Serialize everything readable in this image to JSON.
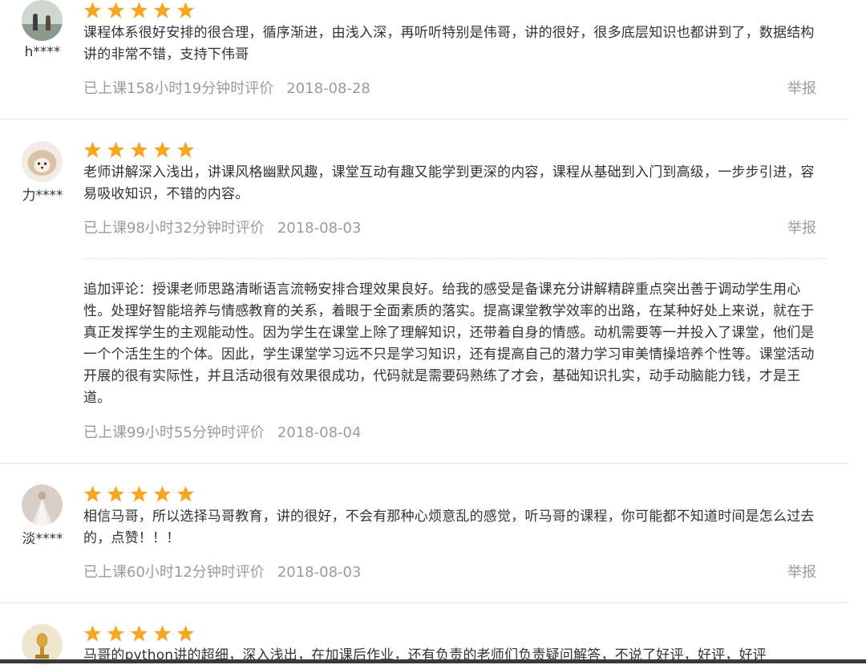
{
  "colors": {
    "star": "#f5a623",
    "meta": "#9b9b9b",
    "text": "#333333",
    "divider": "#e4e4e4"
  },
  "reviews": [
    {
      "username": "h****",
      "rating": 5,
      "avatar_icon": "figures-avatar-icon",
      "comment": "课程体系很好安排的很合理，循序渐进，由浅入深，再听听特别是伟哥，讲的很好，很多底层知识也都讲到了，数据结构讲的非常不错，支持下伟哥",
      "study_time": "已上课158小时19分钟时评价",
      "date": "2018-08-28",
      "report_label": "举报"
    },
    {
      "username": "力****",
      "rating": 5,
      "avatar_icon": "hedgehog-avatar-icon",
      "comment": "老师讲解深入浅出，讲课风格幽默风趣，课堂互动有趣又能学到更深的内容，课程从基础到入门到高级，一步步引进，容易吸收知识，不错的内容。",
      "study_time": "已上课98小时32分钟时评价",
      "date": "2018-08-03",
      "report_label": "举报",
      "followup": {
        "comment": "追加评论：授课老师思路清晰语言流畅安排合理效果良好。给我的感受是备课充分讲解精辟重点突出善于调动学生用心性。处理好智能培养与情感教育的关系，着眼于全面素质的落实。提高课堂教学效率的出路，在某种好处上来说，就在于真正发挥学生的主观能动性。因为学生在课堂上除了理解知识，还带着自身的情感。动机需要等一并投入了课堂，他们是一个个活生生的个体。因此，学生课堂学习远不只是学习知识，还有提高自己的潜力学习审美情操培养个性等。课堂活动开展的很有实际性，并且活动很有效果很成功，代码就是需要码熟练了才会，基础知识扎实，动手动脑能力钱，才是王道。",
        "study_time": "已上课99小时55分钟时评价",
        "date": "2018-08-04"
      }
    },
    {
      "username": "淡****",
      "rating": 5,
      "avatar_icon": "dress-avatar-icon",
      "comment": "相信马哥，所以选择马哥教育，讲的很好，不会有那种心烦意乱的感觉，听马哥的课程，你可能都不知道时间是怎么过去的，点赞！！！",
      "study_time": "已上课60小时12分钟时评价",
      "date": "2018-08-03",
      "report_label": "举报"
    },
    {
      "username": "",
      "rating": 5,
      "avatar_icon": "trophy-avatar-icon",
      "comment": "马哥的python讲的超细，深入浅出，在加课后作业，还有负责的老师们负责疑问解答，不说了好评，好评，好评"
    }
  ]
}
